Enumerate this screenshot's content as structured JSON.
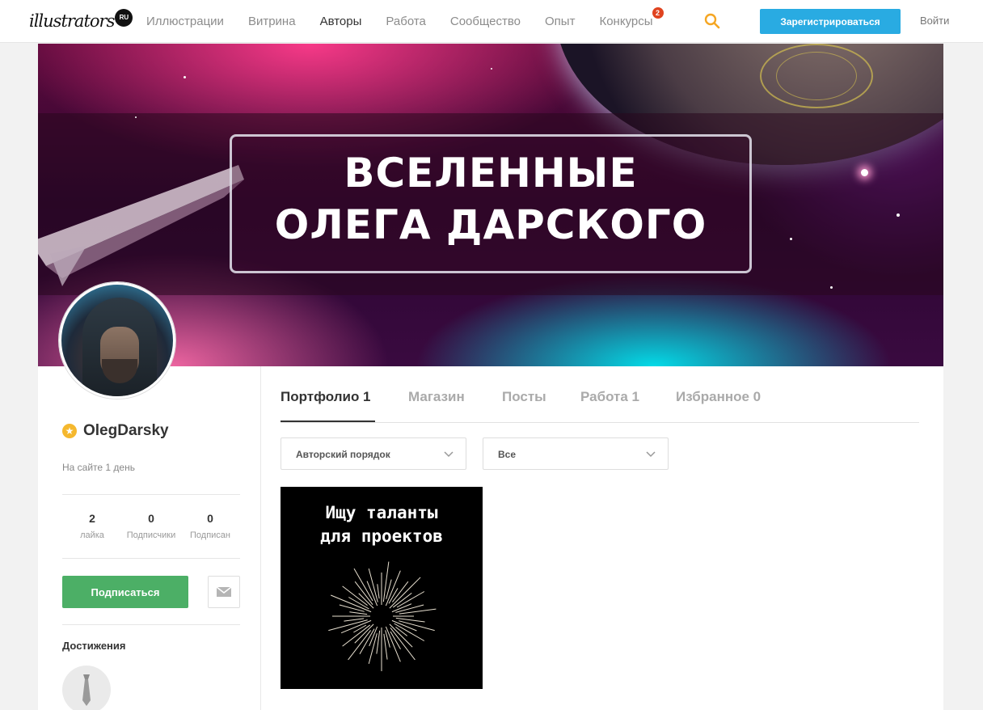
{
  "brand": {
    "logo_text": "illustrators",
    "logo_suffix": "RU"
  },
  "nav": {
    "items": [
      "Иллюстрации",
      "Витрина",
      "Авторы",
      "Работа",
      "Сообщество",
      "Опыт",
      "Конкурсы"
    ],
    "active": "Авторы",
    "contests_badge": "2",
    "register_label": "Зарегистрироваться",
    "login_label": "Войти"
  },
  "cover": {
    "title_line1": "ВСЕЛЕННЫЕ",
    "title_line2": "ОЛЕГА ДАРСКОГО"
  },
  "profile": {
    "username": "OlegDarsky",
    "since": "На сайте 1 день",
    "stats": [
      {
        "value": "2",
        "label": "лайка"
      },
      {
        "value": "0",
        "label": "Подписчики"
      },
      {
        "value": "0",
        "label": "Подписан"
      }
    ],
    "subscribe_label": "Подписаться",
    "achievements_title": "Достижения"
  },
  "tabs": [
    {
      "label": "Портфолио 1",
      "active": true
    },
    {
      "label": "Магазин",
      "active": false
    },
    {
      "label": "Посты",
      "active": false
    },
    {
      "label": "Работа 1",
      "active": false
    },
    {
      "label": "Избранное 0",
      "active": false
    }
  ],
  "filters": {
    "order": "Авторский порядок",
    "category": "Все"
  },
  "portfolio": [
    {
      "text_line1": "Ищу таланты",
      "text_line2": "для проектов"
    }
  ],
  "colors": {
    "accent_blue": "#29abe2",
    "subscribe_green": "#4caf66",
    "badge_red": "#e0431f",
    "star_gold": "#f5b82e"
  },
  "icons": [
    "search-icon",
    "mail-icon",
    "star-icon",
    "chevron-down-icon",
    "tie-icon"
  ]
}
